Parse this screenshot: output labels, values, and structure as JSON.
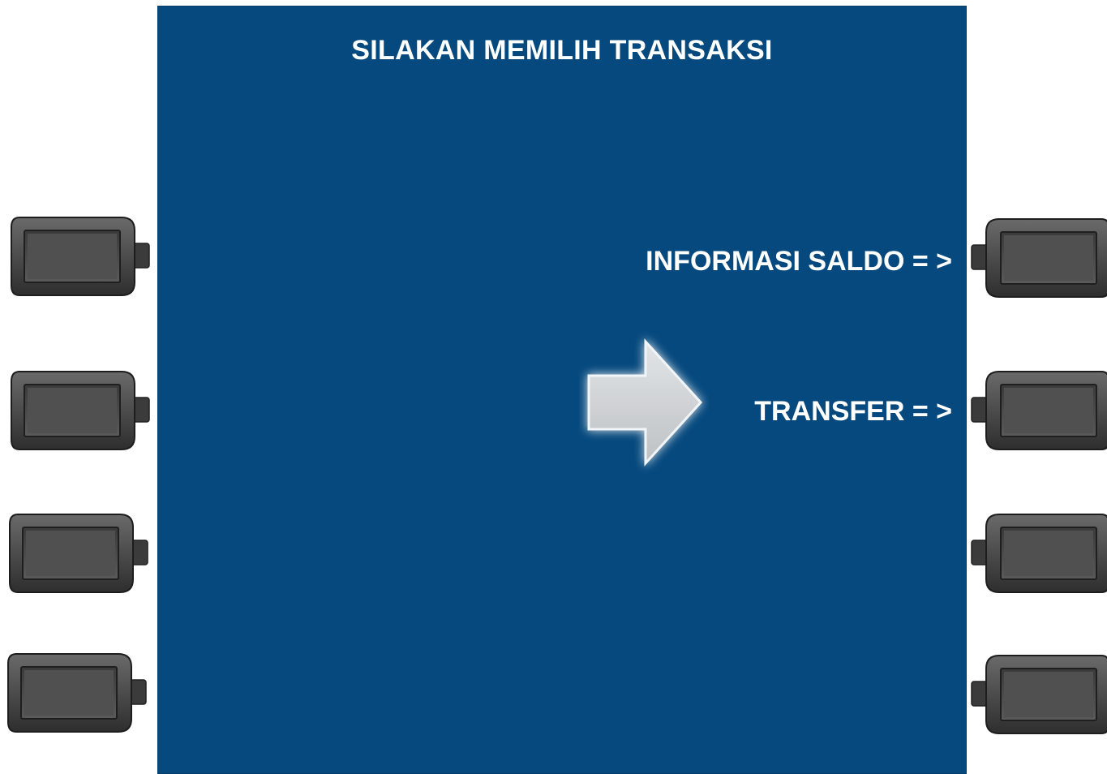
{
  "screen": {
    "title": "SILAKAN MEMILIH TRANSAKSI",
    "background": "#05497e",
    "text_color": "#ffffff"
  },
  "options": {
    "right_1": "INFORMASI SALDO = >",
    "right_2": "TRANSFER = >"
  },
  "side_keys": {
    "left": [
      "left-key-1",
      "left-key-2",
      "left-key-3",
      "left-key-4"
    ],
    "right": [
      "right-key-1",
      "right-key-2",
      "right-key-3",
      "right-key-4"
    ],
    "key_color": "#4a4a4a"
  },
  "pointer": {
    "icon": "arrow-right-icon",
    "color": "#d9d9d9"
  }
}
